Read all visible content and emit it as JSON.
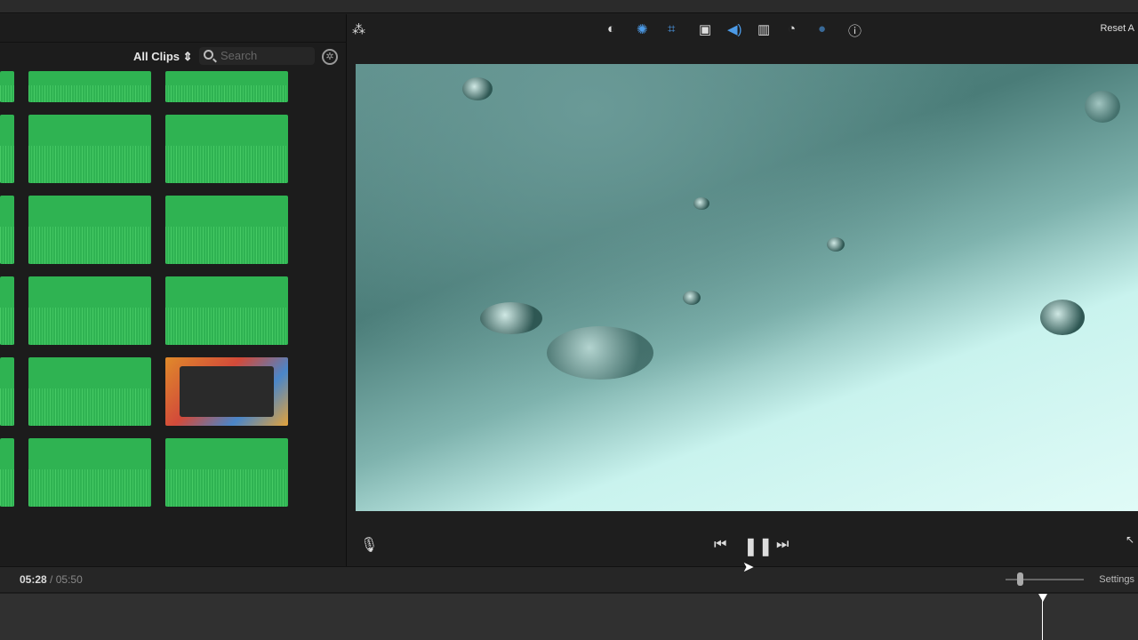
{
  "browser": {
    "filter_label": "All Clips",
    "search_placeholder": "Search"
  },
  "clips": [
    {
      "type": "audio"
    },
    {
      "type": "audio"
    },
    {
      "type": "audio"
    },
    {
      "type": "audio"
    },
    {
      "type": "audio"
    },
    {
      "type": "audio"
    },
    {
      "type": "audio"
    },
    {
      "type": "screenshot"
    },
    {
      "type": "audio"
    },
    {
      "type": "audio"
    },
    {
      "type": "audio"
    },
    {
      "type": "audio"
    }
  ],
  "toolbar": {
    "reset_label": "Reset A",
    "icons": [
      "magic-wand",
      "color-balance",
      "color-correction",
      "crop",
      "stabilization",
      "volume",
      "noise-reduction",
      "speed",
      "clip-filter",
      "info"
    ],
    "active_color": "#4c9be8"
  },
  "timebar": {
    "current": "05:28",
    "separator": "/",
    "total": "05:50",
    "settings_label": "Settings"
  }
}
